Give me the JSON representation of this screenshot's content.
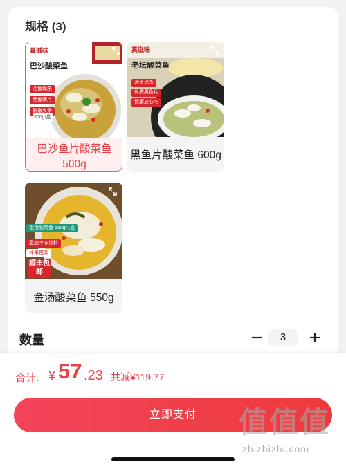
{
  "spec": {
    "title": "规格 (3)",
    "options": [
      {
        "label_line1": "巴沙鱼片酸菜鱼",
        "label_line2": "500g",
        "selected": true,
        "image": {
          "brand": "真滋味",
          "title": "巴沙酸菜鱼",
          "tags": [
            "活鱼现杀",
            "黑鱼薄片",
            "鲜嫩爽滑"
          ],
          "weight": "500g/盒"
        }
      },
      {
        "label": "黑鱼片酸菜鱼 600g",
        "selected": false,
        "image": {
          "brand": "真滋味",
          "title": "老坛酸菜鱼",
          "tags": [
            "活鱼现杀",
            "优质黑鱼片",
            "健康放心吃"
          ]
        }
      },
      {
        "label": "金汤酸菜鱼 550g",
        "selected": false,
        "image": {
          "tags": [
            "金汤酸菜鱼 550g*1盒",
            "急速冷冻锁鲜",
            "坪单包邮",
            "顺丰包邮"
          ]
        }
      }
    ]
  },
  "quantity": {
    "label": "数量",
    "value": "3",
    "minus": "−",
    "plus": "+"
  },
  "footer": {
    "total_label": "合计:",
    "currency": "¥",
    "price_int": "57",
    "price_dec": ".23",
    "discount": "共减¥119.77",
    "pay_button": "立即支付"
  },
  "watermark": {
    "glyphs": [
      "值",
      "值",
      "值"
    ],
    "site": "zhizhizhi.com"
  },
  "colors": {
    "accent": "#e8414a",
    "button": "#ef3d45",
    "selected_bg": "#fff0ef"
  }
}
